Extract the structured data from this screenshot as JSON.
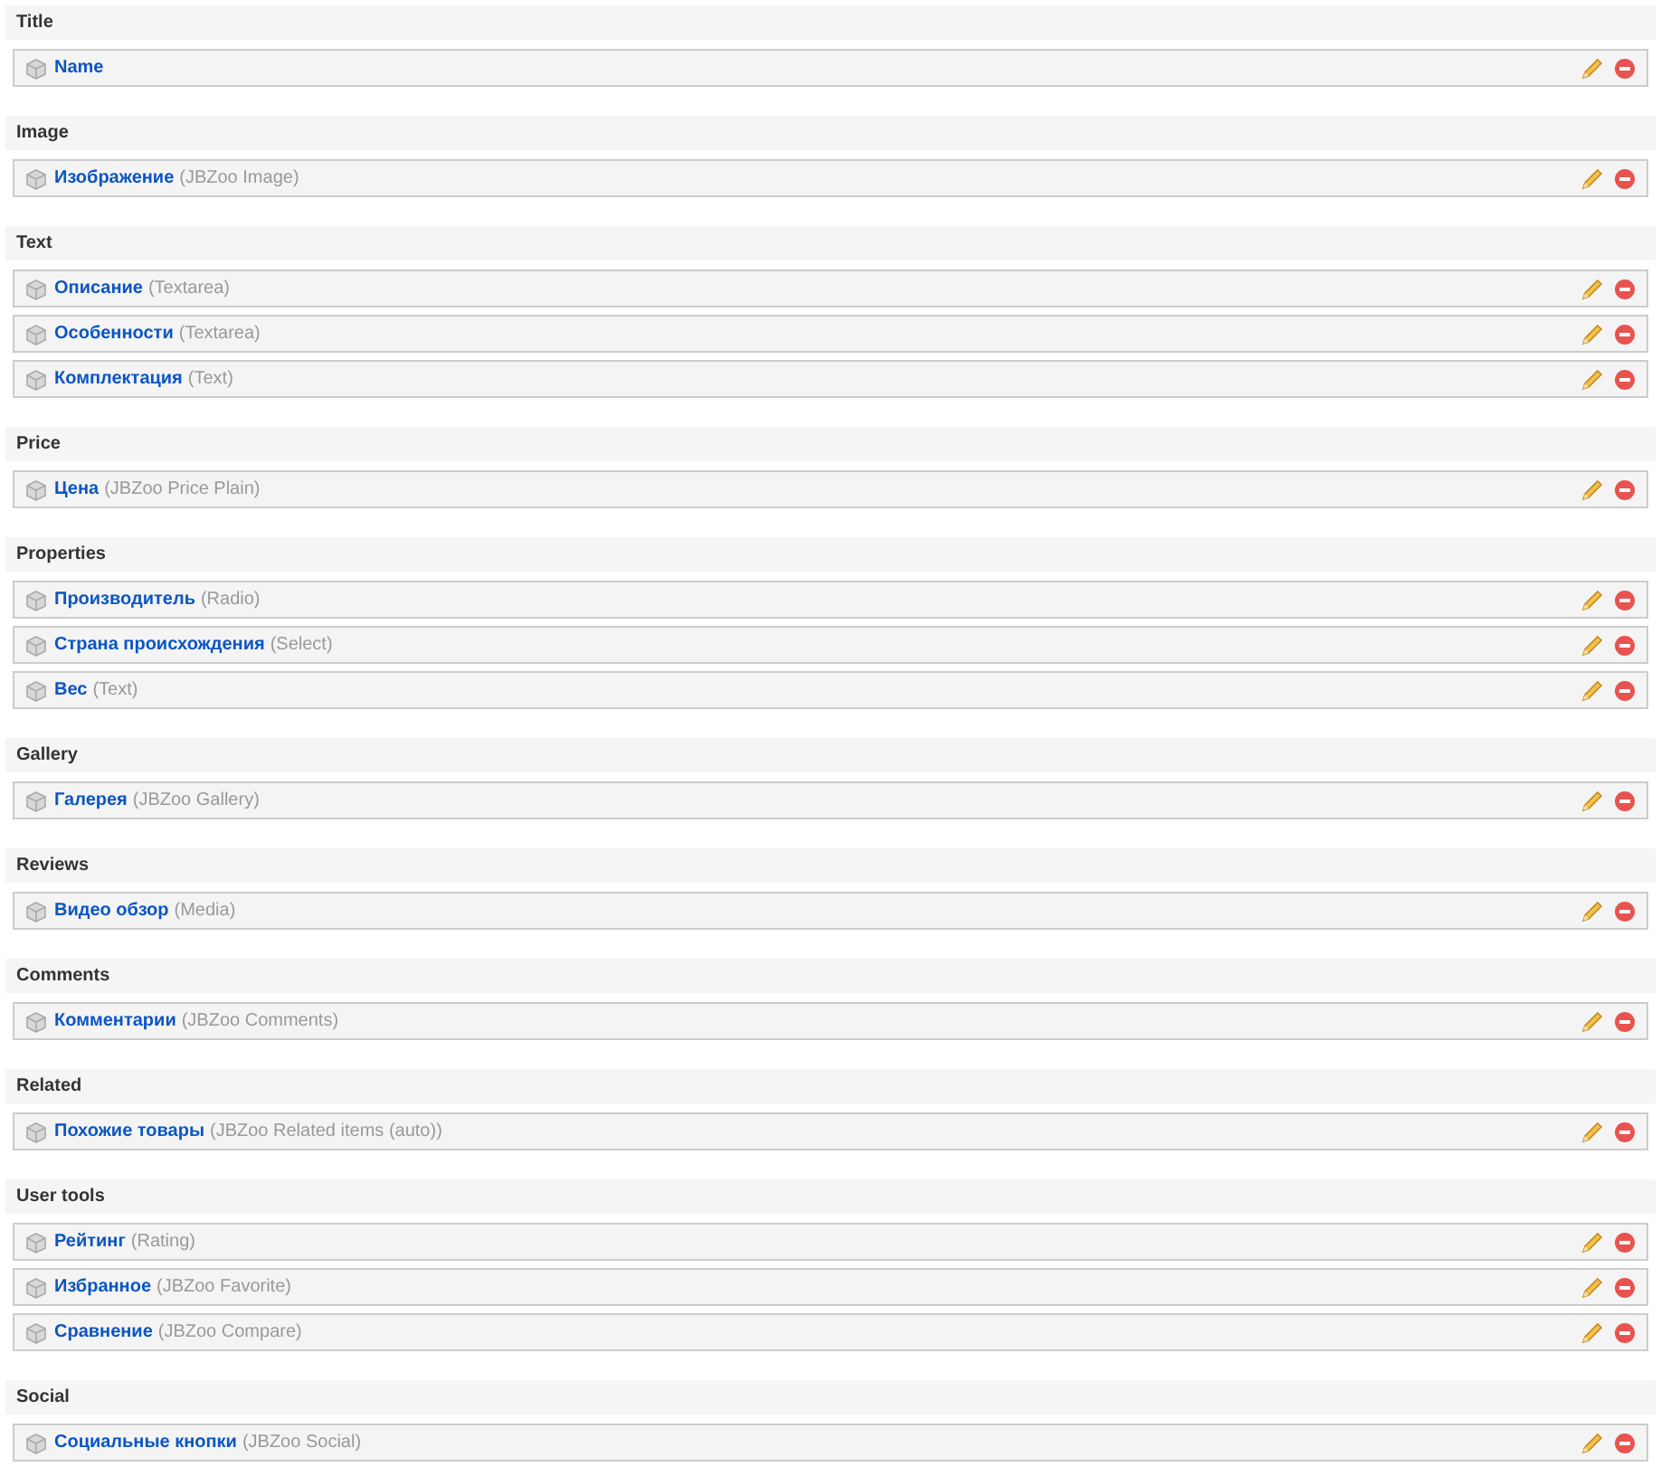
{
  "sections": [
    {
      "title": "Title",
      "fields": [
        {
          "name": "Name"
        }
      ]
    },
    {
      "title": "Image",
      "fields": [
        {
          "name": "Изображение",
          "type": "(JBZoo Image)"
        }
      ]
    },
    {
      "title": "Text",
      "fields": [
        {
          "name": "Описание",
          "type": "(Textarea)"
        },
        {
          "name": "Особенности",
          "type": "(Textarea)"
        },
        {
          "name": "Комплектация",
          "type": "(Text)"
        }
      ]
    },
    {
      "title": "Price",
      "fields": [
        {
          "name": "Цена",
          "type": "(JBZoo Price Plain)"
        }
      ]
    },
    {
      "title": "Properties",
      "fields": [
        {
          "name": "Производитель",
          "type": "(Radio)"
        },
        {
          "name": "Страна происхождения",
          "type": "(Select)"
        },
        {
          "name": "Вес",
          "type": "(Text)"
        }
      ]
    },
    {
      "title": "Gallery",
      "fields": [
        {
          "name": "Галерея",
          "type": "(JBZoo Gallery)"
        }
      ]
    },
    {
      "title": "Reviews",
      "fields": [
        {
          "name": "Видео обзор",
          "type": "(Media)"
        }
      ]
    },
    {
      "title": "Comments",
      "fields": [
        {
          "name": "Комментарии",
          "type": "(JBZoo Comments)"
        }
      ]
    },
    {
      "title": "Related",
      "fields": [
        {
          "name": "Похожие товары",
          "type": "(JBZoo Related items (auto))"
        }
      ]
    },
    {
      "title": "User tools",
      "fields": [
        {
          "name": "Рейтинг",
          "type": "(Rating)"
        },
        {
          "name": "Избранное",
          "type": "(JBZoo Favorite)"
        },
        {
          "name": "Сравнение",
          "type": "(JBZoo Compare)"
        }
      ]
    },
    {
      "title": "Social",
      "fields": [
        {
          "name": "Социальные кнопки",
          "type": "(JBZoo Social)"
        }
      ]
    }
  ]
}
